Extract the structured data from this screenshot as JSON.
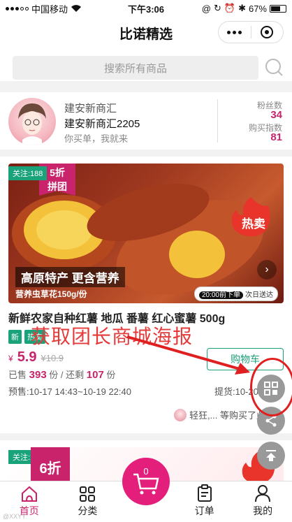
{
  "status": {
    "carrier": "中国移动",
    "time": "下午3:06",
    "battery": "67%",
    "battery_level": 0.67
  },
  "navbar": {
    "title": "比诺精选"
  },
  "search": {
    "placeholder": "搜索所有商品"
  },
  "leader": {
    "name": "建安新商汇",
    "shop": "建安新商汇2205",
    "slogan": "你买单，我就来",
    "fans_label": "粉丝数",
    "fans_value": "34",
    "index_label": "购买指数",
    "index_value": "81"
  },
  "product": {
    "follow": "关注:188",
    "discount_line1": "5折",
    "discount_line2": "拼团",
    "hot_label": "热卖",
    "slogan": "高原特产 更含营养",
    "spec": "营养虫草花150g/份",
    "delivery_time": "20:00前下单",
    "delivery_note": "次日送达",
    "title": "新鲜农家自种红薯 地瓜 番薯 红心蜜薯 500g",
    "tags": [
      "新",
      "热卖"
    ],
    "currency": "¥",
    "price": "5.9",
    "orig_price": "¥10.9",
    "cart_label": "购物车",
    "sold_label": "已售",
    "sold_value": "393",
    "sold_unit": "份 / 还剩",
    "remain_value": "107",
    "remain_unit": "份",
    "presale": "预售:10-17 14:43~10-19 22:40",
    "pickup": "提货:10-20 22:10",
    "buyers": "轻狂,... 等购买了此商品"
  },
  "annotation": {
    "text": "获取团长商城海报"
  },
  "product2": {
    "follow": "关注:109",
    "discount": "6折"
  },
  "tabbar": {
    "home": "首页",
    "category": "分类",
    "cart_count": "0",
    "orders": "订单",
    "mine": "我的"
  },
  "watermark": "@XXYY"
}
